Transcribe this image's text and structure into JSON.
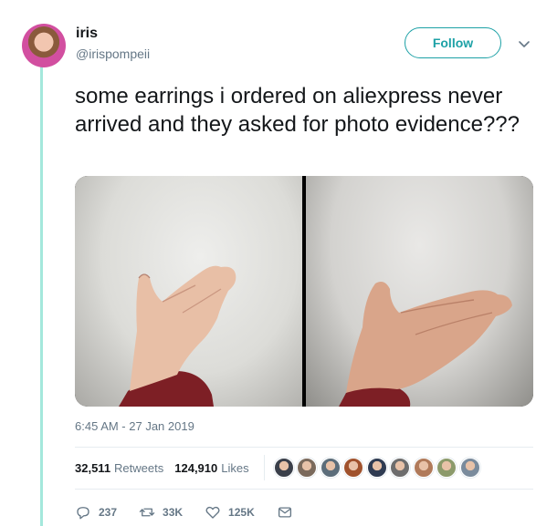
{
  "tweet": {
    "author_name": "iris",
    "author_handle": "@irispompeii",
    "follow_label": "Follow",
    "text": "some earrings i ordered on aliexpress never arrived and they asked for photo evidence???",
    "timestamp": "6:45 AM - 27 Jan 2019"
  },
  "stats": {
    "retweets_count": "32,511",
    "retweets_label": "Retweets",
    "likes_count": "124,910",
    "likes_label": "Likes"
  },
  "likers": [
    "#3a3f4a",
    "#7b6a5c",
    "#5c6d7a",
    "#a0522d",
    "#2f3b52",
    "#6d6d6d",
    "#b07a5a",
    "#8c9a6b",
    "#7a8b9c"
  ],
  "actions": {
    "replies": "237",
    "retweets": "33K",
    "likes": "125K"
  },
  "colors": {
    "accent": "#1da1a6",
    "thread_line": "#a4e8dc",
    "secondary_text": "#657786"
  }
}
